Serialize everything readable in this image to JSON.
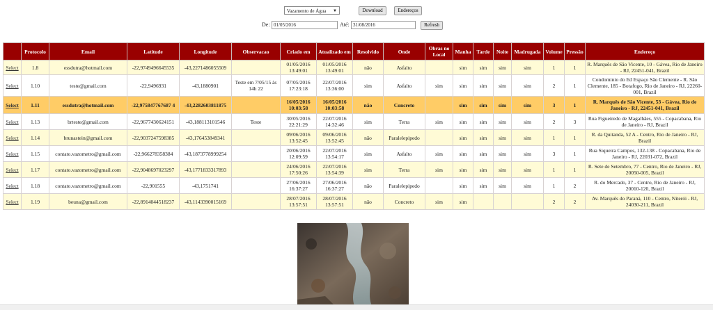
{
  "toolbar": {
    "filter_select": "Vazamento de Água",
    "download_label": "Download",
    "enderecos_label": "Endereços"
  },
  "date_filter": {
    "de_label": "De:",
    "de_value": "01/05/2016",
    "ate_label": "Até:",
    "ate_value": "31/08/2016",
    "refresh_label": "Refresh"
  },
  "table": {
    "headers": [
      "",
      "Protocolo",
      "Email",
      "Latitude",
      "Longitude",
      "Observacao",
      "Criado em",
      "Atualizado em",
      "Resolvido",
      "Onde",
      "Obras no Local",
      "Manha",
      "Tarde",
      "Noite",
      "Madrugada",
      "Volume",
      "Pressão",
      "Endereço"
    ],
    "rows": [
      {
        "select": "Select",
        "protocolo": "1.8",
        "email": "essdutra@hotmail.com",
        "latitude": "-22,9749496645535",
        "longitude": "-43,2271486055509",
        "observacao": "",
        "criado": "01/05/2016 13:49:01",
        "atualizado": "01/05/2016 13:49:01",
        "resolvido": "não",
        "onde": "Asfalto",
        "obras": "",
        "manha": "sim",
        "tarde": "sim",
        "noite": "sim",
        "madrugada": "sim",
        "volume": "1",
        "pressao": "1",
        "endereco": "R. Marquês de São Vicente, 10 - Gávea, Rio de Janeiro - RJ, 22451-041, Brazil"
      },
      {
        "select": "Select",
        "protocolo": "1.10",
        "email": "teste@gmail.com",
        "latitude": "-22,9496931",
        "longitude": "-43,1880901",
        "observacao": "Teste em 7/05/15 às 14h 22",
        "criado": "07/05/2016 17:23:18",
        "atualizado": "22/07/2016 13:36:00",
        "resolvido": "sim",
        "onde": "Asfalto",
        "obras": "sim",
        "manha": "sim",
        "tarde": "sim",
        "noite": "sim",
        "madrugada": "sim",
        "volume": "2",
        "pressao": "1",
        "endereco": "Condominio do Ed Espaço São Clemente - R. São Clemente, 185 - Botafogo, Rio de Janeiro - RJ, 22260-001, Brazil"
      },
      {
        "select": "Select",
        "protocolo": "1.11",
        "email": "essdutra@hotmail.com",
        "latitude": "-22,975847767687 4",
        "longitude": "-43,2282603811875",
        "observacao": "",
        "criado": "16/05/2016 10:03:58",
        "atualizado": "16/05/2016 10:03:58",
        "resolvido": "não",
        "onde": "Concreto",
        "obras": "",
        "manha": "sim",
        "tarde": "sim",
        "noite": "sim",
        "madrugada": "sim",
        "volume": "3",
        "pressao": "1",
        "endereco": "R. Marquês de São Vicente, 53 - Gávea, Rio de Janeiro - RJ, 22451-041, Brazil"
      },
      {
        "select": "Select",
        "protocolo": "1.13",
        "email": "brteste@gmail.com",
        "latitude": "-22,9677430624151",
        "longitude": "-43,188113101546",
        "observacao": "Teste",
        "criado": "30/05/2016 22:21:29",
        "atualizado": "22/07/2016 14:32:46",
        "resolvido": "sim",
        "onde": "Terra",
        "obras": "sim",
        "manha": "sim",
        "tarde": "sim",
        "noite": "sim",
        "madrugada": "sim",
        "volume": "2",
        "pressao": "3",
        "endereco": "Rua Figueiredo de Magalhães, 555 - Copacabana, Rio de Janeiro - RJ, Brazil"
      },
      {
        "select": "Select",
        "protocolo": "1.14",
        "email": "brunastein@gmail.com",
        "latitude": "-22,9037247598385",
        "longitude": "-43,176453849341",
        "observacao": "",
        "criado": "09/06/2016 13:52:45",
        "atualizado": "09/06/2016 13:52:45",
        "resolvido": "não",
        "onde": "Paralelepipedo",
        "obras": "",
        "manha": "sim",
        "tarde": "sim",
        "noite": "sim",
        "madrugada": "sim",
        "volume": "1",
        "pressao": "1",
        "endereco": "R. da Quitanda, 52 A - Centro, Rio de Janeiro - RJ, Brazil"
      },
      {
        "select": "Select",
        "protocolo": "1.15",
        "email": "contato.vazometro@gmail.com",
        "latitude": "-22,966278358384",
        "longitude": "-43,1873778999254",
        "observacao": "",
        "criado": "20/06/2016 12:09:59",
        "atualizado": "22/07/2016 13:54:17",
        "resolvido": "sim",
        "onde": "Asfalto",
        "obras": "sim",
        "manha": "sim",
        "tarde": "sim",
        "noite": "sim",
        "madrugada": "sim",
        "volume": "3",
        "pressao": "1",
        "endereco": "Rua Siqueira Campos, 132-138 - Copacabana, Rio de Janeiro - RJ, 22031-072, Brazil"
      },
      {
        "select": "Select",
        "protocolo": "1.17",
        "email": "contato.vazometro@gmail.com",
        "latitude": "-22,9048697023297",
        "longitude": "-43,1771833317893",
        "observacao": "",
        "criado": "24/06/2016 17:50:26",
        "atualizado": "22/07/2016 13:54:39",
        "resolvido": "sim",
        "onde": "Terra",
        "obras": "sim",
        "manha": "sim",
        "tarde": "sim",
        "noite": "sim",
        "madrugada": "sim",
        "volume": "1",
        "pressao": "1",
        "endereco": "R. Sete de Setembro, 77 - Centro, Rio de Janeiro - RJ, 20050-005, Brazil"
      },
      {
        "select": "Select",
        "protocolo": "1.18",
        "email": "contato.vazometro@gmail.com",
        "latitude": "-22,901555",
        "longitude": "-43,1751741",
        "observacao": "",
        "criado": "27/06/2016 16:37:27",
        "atualizado": "27/06/2016 16:37:27",
        "resolvido": "não",
        "onde": "Paralelepipedo",
        "obras": "",
        "manha": "sim",
        "tarde": "sim",
        "noite": "sim",
        "madrugada": "sim",
        "volume": "1",
        "pressao": "2",
        "endereco": "R. do Mercado, 37 - Centro, Rio de Janeiro - RJ, 20010-120, Brazil"
      },
      {
        "select": "Select",
        "protocolo": "1.19",
        "email": "beuna@gmail.com",
        "latitude": "-22,8914044518237",
        "longitude": "-43,1143390015169",
        "observacao": "",
        "criado": "28/07/2016 13:57:51",
        "atualizado": "28/07/2016 13:57:51",
        "resolvido": "não",
        "onde": "Concreto",
        "obras": "sim",
        "manha": "sim",
        "tarde": "",
        "noite": "",
        "madrugada": "",
        "volume": "2",
        "pressao": "2",
        "endereco": "Av. Marquês do Paraná, 110 - Centro, Niterói - RJ, 24030-211, Brazil"
      }
    ]
  },
  "colors": {
    "header_bg": "#990000",
    "row_alt_bg": "#fffbd6",
    "selected_row_bg": "#ffcc66"
  }
}
